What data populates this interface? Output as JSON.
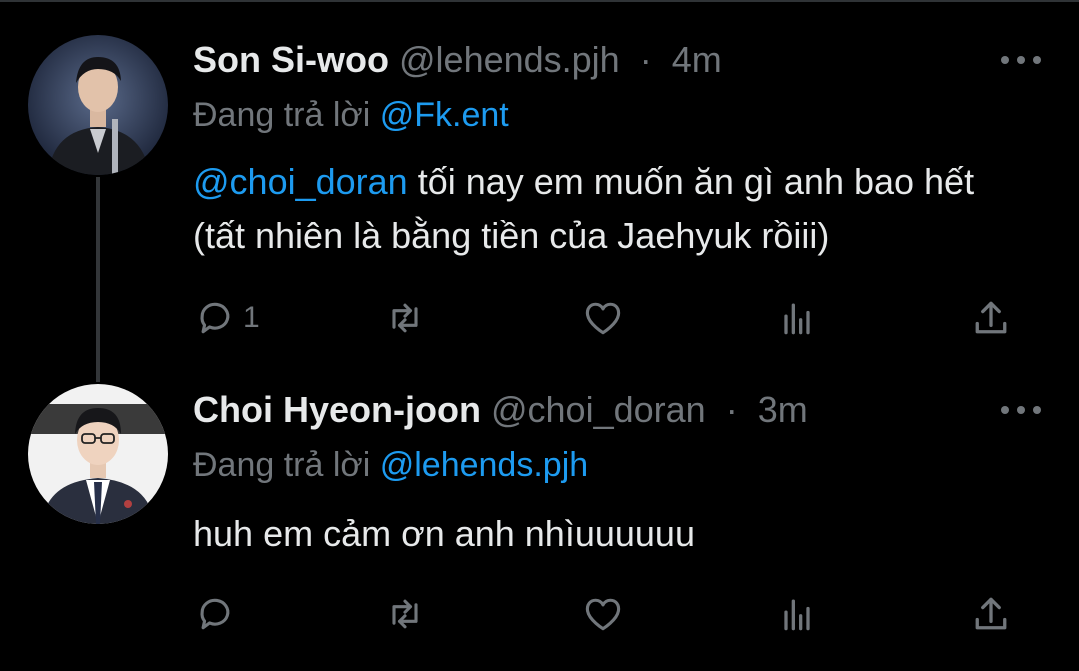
{
  "tweets": [
    {
      "name": "Son Si-woo",
      "handle": "@lehends.pjh",
      "separator": "·",
      "time": "4m",
      "replying_prefix": "Đang trả lời",
      "replying_to": "@Fk.ent",
      "mention": "@choi_doran",
      "text": " tối nay em muốn ăn gì anh bao hết (tất nhiên là bằng tiền của Jaehyuk rồiii)",
      "reply_count": "1",
      "avatar": "man-in-suit-smiling"
    },
    {
      "name": "Choi Hyeon-joon",
      "handle": "@choi_doran",
      "separator": "·",
      "time": "3m",
      "replying_prefix": "Đang trả lời",
      "replying_to": "@lehends.pjh",
      "text": "huh em cảm ơn anh nhìuuuuuu",
      "reply_count": "",
      "avatar": "young-man-with-glasses-in-blazer"
    }
  ],
  "colors": {
    "background": "#000000",
    "text": "#e7e9ea",
    "muted": "#71767b",
    "accent": "#1d9bf0",
    "thread_line": "#333639"
  },
  "icons": [
    "more-icon",
    "reply-icon",
    "retweet-icon",
    "like-icon",
    "views-icon",
    "share-icon"
  ]
}
